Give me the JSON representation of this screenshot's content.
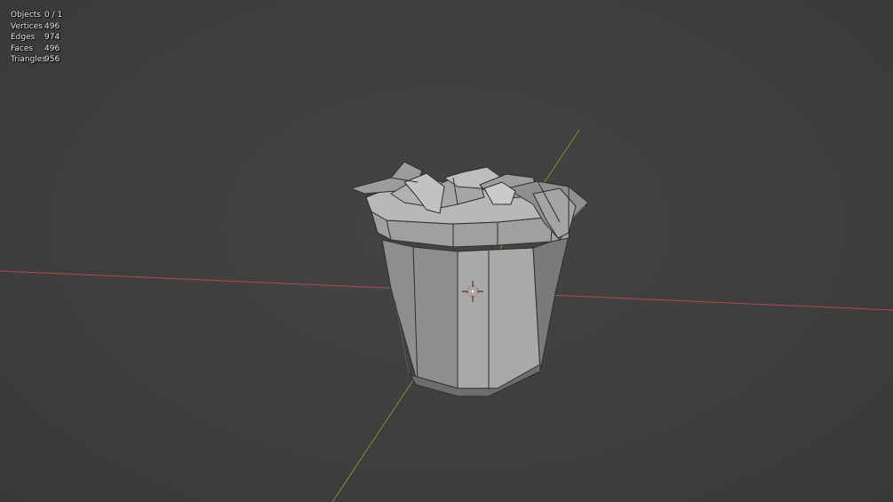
{
  "statistics": [
    {
      "label": "Objects",
      "value": "0 / 1"
    },
    {
      "label": "Vertices",
      "value": "496"
    },
    {
      "label": "Edges",
      "value": "974"
    },
    {
      "label": "Faces",
      "value": "496"
    },
    {
      "label": "Triangles",
      "value": "956"
    }
  ],
  "colors": {
    "background": "#3d3d3d",
    "x_axis": "#b04a56",
    "y_axis": "#6f9a2c",
    "mesh_light": "#b5b5b5",
    "mesh_mid": "#9a9a9a",
    "mesh_dark": "#6e6e6e",
    "wire": "#2e2e2e",
    "cursor": "#d07070"
  },
  "icons": [
    "3d-cursor-icon"
  ]
}
